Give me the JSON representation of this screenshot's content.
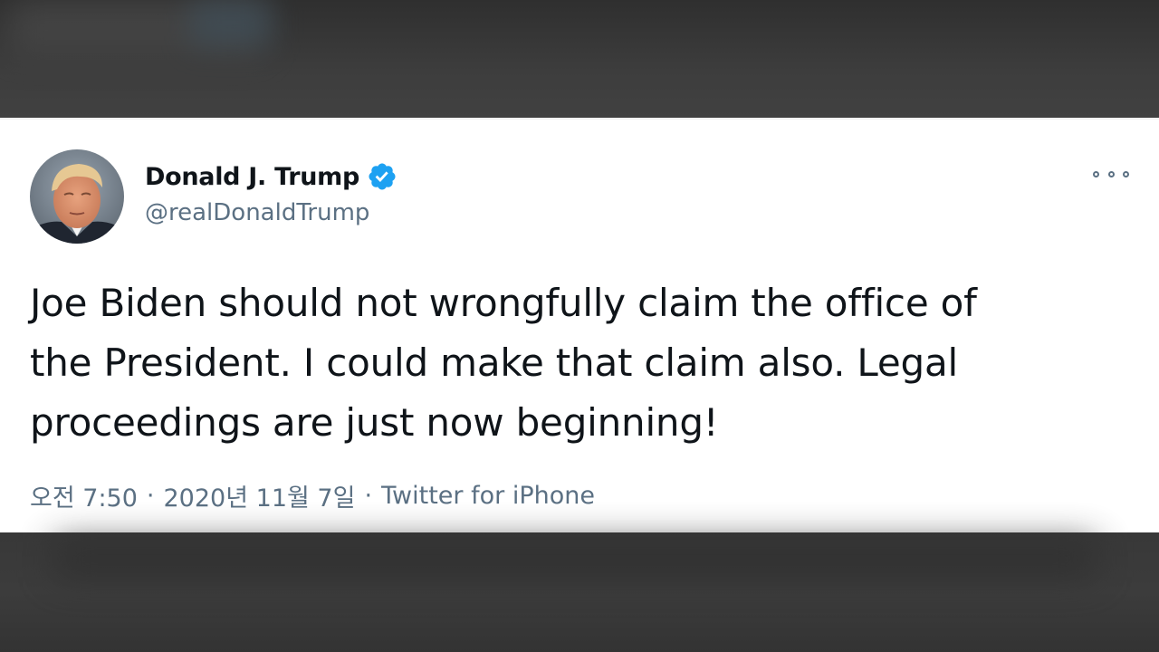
{
  "tweet": {
    "author": {
      "display_name": "Donald J. Trump",
      "handle": "@realDonaldTrump",
      "verified": true
    },
    "text": "Joe Biden should not wrongfully claim the office of\nthe President. I could make that claim also. Legal\nproceedings are just now beginning!",
    "time": "오전 7:50",
    "date": "2020년 11월 7일",
    "source": "Twitter for iPhone",
    "separator": "·"
  },
  "colors": {
    "text_primary": "#0f1419",
    "text_secondary": "#5b7083",
    "verified_badge": "#1da1f2",
    "card_background": "#ffffff",
    "page_background": "#3b3b3b"
  },
  "icons": {
    "verified": "verified-badge-icon",
    "more": "more-options-icon"
  }
}
